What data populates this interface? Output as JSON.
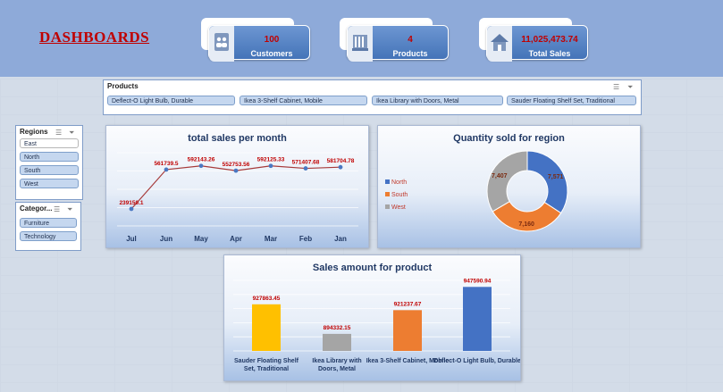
{
  "header": {
    "title": "DASHBOARDS"
  },
  "kpis": [
    {
      "value": "100",
      "label": "Customers",
      "icon": "people-icon"
    },
    {
      "value": "4",
      "label": "Products",
      "icon": "factory-icon"
    },
    {
      "value": "11,025,473.74",
      "label": "Total Sales",
      "icon": "house-icon"
    }
  ],
  "products_slicer": {
    "header": "Products",
    "items": [
      "Deflect-O Light Bulb, Durable",
      "Ikea 3-Shelf Cabinet, Mobile",
      "Ikea Library with Doors, Metal",
      "Sauder Floating Shelf Set, Traditional"
    ]
  },
  "regions_slicer": {
    "header": "Regions",
    "items": [
      "East",
      "North",
      "South",
      "West"
    ]
  },
  "category_slicer": {
    "header": "Categor...",
    "items": [
      "Furniture",
      "Technology"
    ]
  },
  "chart_data": [
    {
      "type": "line",
      "title": "total sales per month",
      "categories": [
        "Jul",
        "Jun",
        "May",
        "Apr",
        "Mar",
        "Feb",
        "Jan"
      ],
      "values": [
        239150.1,
        561739.5,
        592143.26,
        552753.56,
        592125.33,
        571407.68,
        581704.78
      ],
      "value_labels": [
        "239150.1",
        "561739.5",
        "592143.26",
        "552753.56",
        "592125.33",
        "571407.68",
        "581704.78"
      ],
      "ylim": [
        100000,
        700000
      ],
      "colors": {
        "line": "#a63a3a",
        "marker": "#4a78c2",
        "label": "#c00000"
      }
    },
    {
      "type": "pie",
      "title": "Quantity sold for region",
      "categories": [
        "North",
        "South",
        "West"
      ],
      "values": [
        7571,
        7160,
        7407
      ],
      "value_labels": [
        "7,571",
        "7,160",
        "7,407"
      ],
      "legend": "left",
      "colors": [
        "#4472c4",
        "#ed7d31",
        "#a5a5a5"
      ]
    },
    {
      "type": "bar",
      "title": "Sales amount for product",
      "categories": [
        "Sauder Floating Shelf Set, Traditional",
        "Ikea Library with Doors, Metal",
        "Ikea 3-Shelf Cabinet, Mobile",
        "Deflect-O Light Bulb, Durable"
      ],
      "values": [
        927863.45,
        894332.15,
        921237.67,
        947590.94
      ],
      "value_labels": [
        "927863.45",
        "894332.15",
        "921237.67",
        "947590.94"
      ],
      "ylim": [
        875000,
        955000
      ],
      "colors": [
        "#ffc000",
        "#a5a5a5",
        "#ed7d31",
        "#4472c4"
      ]
    }
  ]
}
